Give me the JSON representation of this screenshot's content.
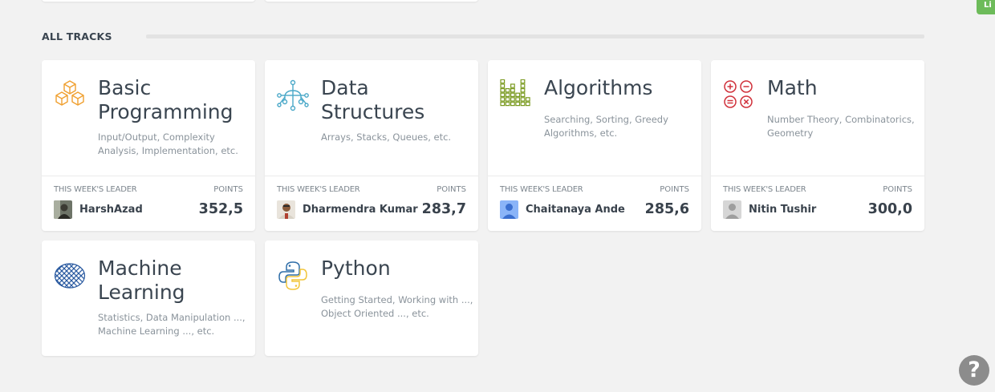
{
  "section": {
    "title": "ALL TRACKS"
  },
  "side_tab": {
    "label": "Li"
  },
  "cards": [
    {
      "title": "Basic Programming",
      "description": "Input/Output, Complexity Analysis, Implementation, etc.",
      "icon": "cubes-icon",
      "leader_label": "THIS WEEK'S LEADER",
      "points_label": "POINTS",
      "leader": "HarshAzad",
      "points": "352,5"
    },
    {
      "title": "Data Structures",
      "description": "Arrays, Stacks, Queues, etc.",
      "icon": "tree-icon",
      "leader_label": "THIS WEEK'S LEADER",
      "points_label": "POINTS",
      "leader": "Dharmendra Kumar",
      "points": "283,7"
    },
    {
      "title": "Algorithms",
      "description": "Searching, Sorting, Greedy Algorithms, etc.",
      "icon": "grid-bars-icon",
      "leader_label": "THIS WEEK'S LEADER",
      "points_label": "POINTS",
      "leader": "Chaitanaya Ande",
      "points": "285,6"
    },
    {
      "title": "Math",
      "description": "Number Theory, Combinatorics, Geometry",
      "icon": "math-operators-icon",
      "leader_label": "THIS WEEK'S LEADER",
      "points_label": "POINTS",
      "leader": "Nitin Tushir",
      "points": "300,0"
    },
    {
      "title": "Machine Learning",
      "description": "Statistics, Data Manipulation ..., Machine Learning ..., etc.",
      "icon": "mesh-icon"
    },
    {
      "title": "Python",
      "description": "Getting Started, Working with ..., Object Oriented ..., etc.",
      "icon": "python-icon"
    }
  ],
  "help": {
    "label": "?"
  },
  "colors": {
    "background": "#f2f2f2",
    "card": "#ffffff",
    "orange": "#f0a030",
    "teal": "#4aa8c8",
    "green": "#7a9a20",
    "red": "#d0303a",
    "navy": "#2a5aa0",
    "python_yellow": "#f2c53a",
    "side_tab": "#6dbb5a"
  }
}
